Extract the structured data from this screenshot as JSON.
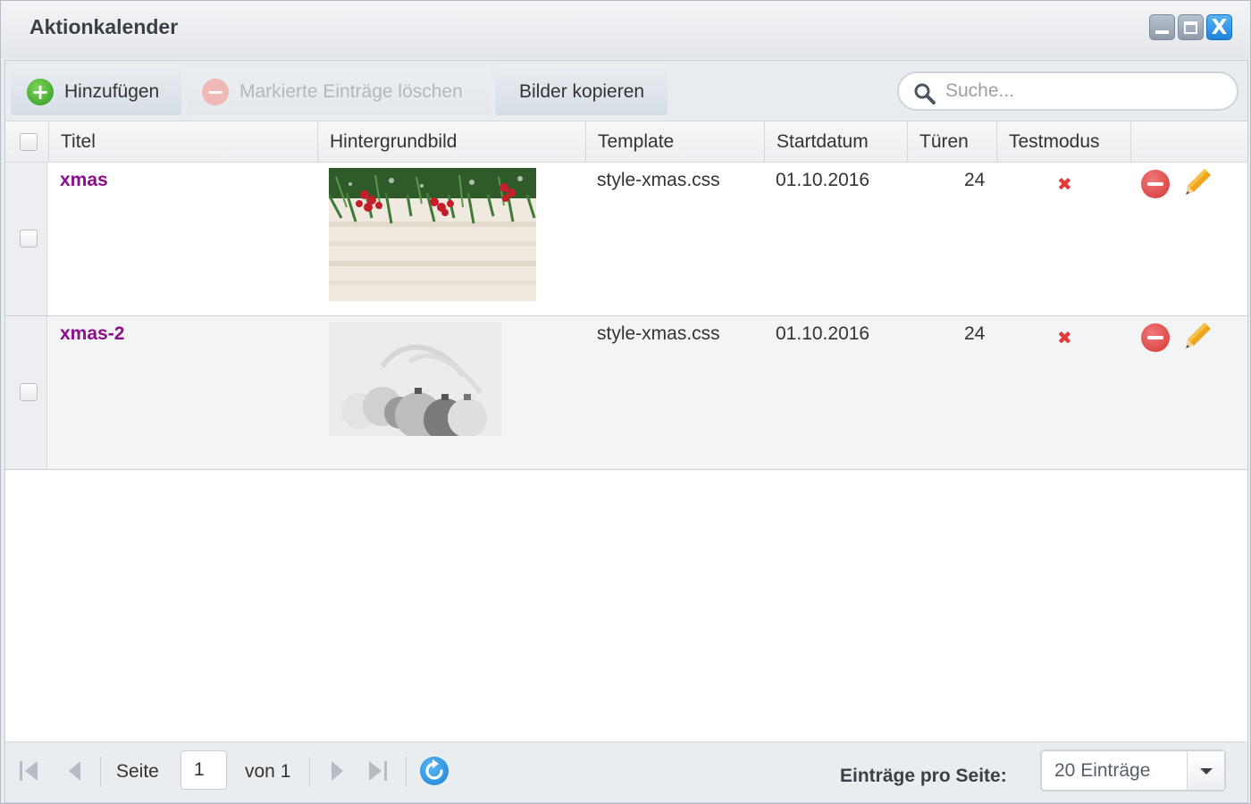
{
  "window": {
    "title": "Aktionkalender",
    "controls": [
      "minimize-icon",
      "maximize-icon",
      "close-icon"
    ],
    "close_glyph": "X"
  },
  "toolbar": {
    "add_label": "Hinzufügen",
    "delete_label": "Markierte Einträge löschen",
    "copy_label": "Bilder kopieren",
    "search_placeholder": "Suche..."
  },
  "grid": {
    "columns": [
      "Titel",
      "Hintergrundbild",
      "Template",
      "Startdatum",
      "Türen",
      "Testmodus"
    ],
    "rows": [
      {
        "title": "xmas",
        "image": "christmas-fir-branches-berries-on-white-wood",
        "template": "style-xmas.css",
        "start": "01.10.2016",
        "doors": "24",
        "testmode_icon": "x-icon",
        "testmode_glyph": "✖"
      },
      {
        "title": "xmas-2",
        "image": "silver-christmas-baubles",
        "template": "style-xmas.css",
        "start": "01.10.2016",
        "doors": "24",
        "testmode_icon": "x-icon",
        "testmode_glyph": "✖"
      }
    ]
  },
  "pager": {
    "page_label": "Seite",
    "page_value": "1",
    "of_label": "von 1",
    "per_page_label": "Einträge pro Seite:",
    "per_page_value": "20 Einträge"
  },
  "colors": {
    "title_link": "#8b0e8b",
    "add_icon": "#2e9a1f",
    "delete_icon": "#d63535",
    "refresh_icon": "#1a7fd4",
    "edit_icon": "#e8a020"
  }
}
